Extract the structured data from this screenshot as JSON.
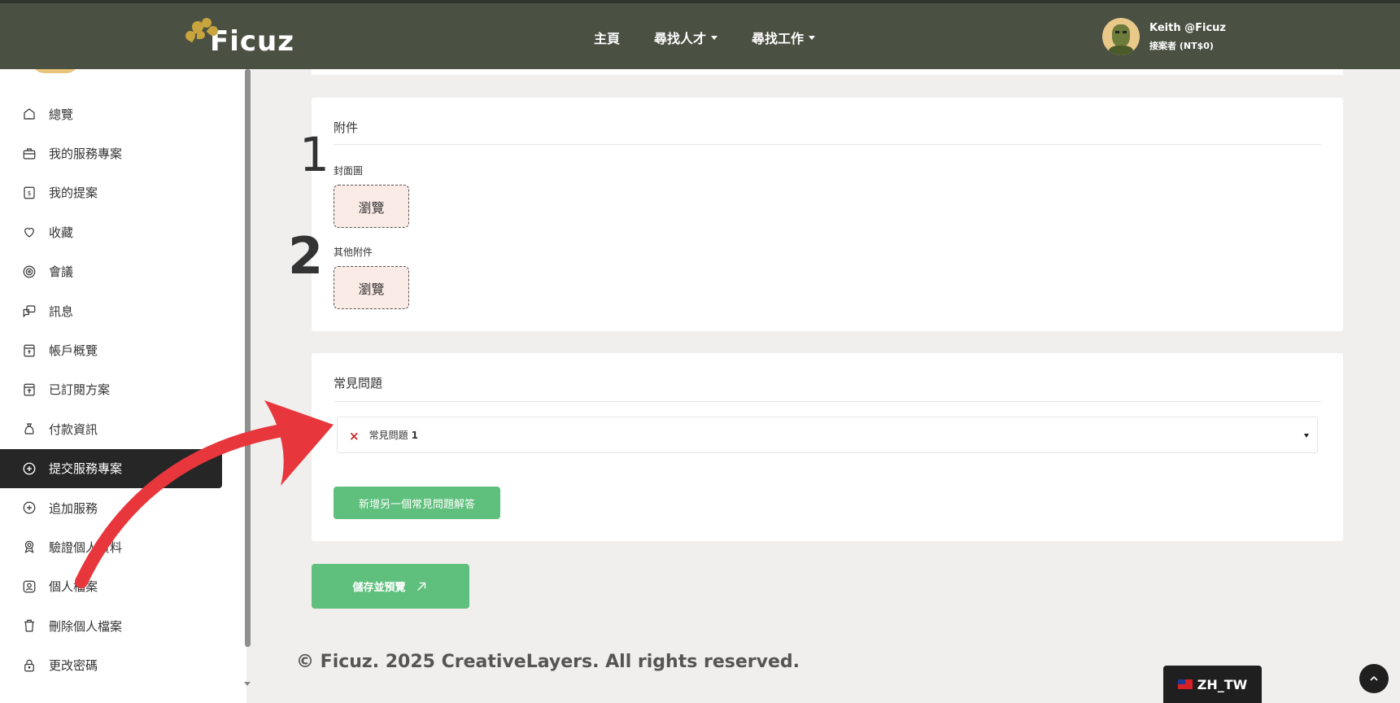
{
  "header": {
    "logo_text": "Ficuz",
    "nav": [
      {
        "label": "主頁",
        "has_caret": false
      },
      {
        "label": "尋找人才",
        "has_caret": true
      },
      {
        "label": "尋找工作",
        "has_caret": true
      }
    ],
    "user": {
      "name": "Keith @Ficuz",
      "role": "接案者 (NT$0)"
    }
  },
  "sidebar": {
    "items": [
      {
        "label": "總覽",
        "icon": "home-icon"
      },
      {
        "label": "我的服務專案",
        "icon": "briefcase-icon"
      },
      {
        "label": "我的提案",
        "icon": "dollar-file-icon"
      },
      {
        "label": "收藏",
        "icon": "heart-icon"
      },
      {
        "label": "會議",
        "icon": "target-icon"
      },
      {
        "label": "訊息",
        "icon": "chat-icon"
      },
      {
        "label": "帳戶概覽",
        "icon": "account-icon"
      },
      {
        "label": "已訂閱方案",
        "icon": "subscription-icon"
      },
      {
        "label": "付款資訊",
        "icon": "money-bag-icon"
      },
      {
        "label": "提交服務專案",
        "icon": "plus-circle-icon",
        "active": true
      },
      {
        "label": "追加服務",
        "icon": "plus-circle-icon"
      },
      {
        "label": "驗證個人資料",
        "icon": "badge-icon"
      },
      {
        "label": "個人檔案",
        "icon": "profile-icon"
      },
      {
        "label": "刪除個人檔案",
        "icon": "trash-icon"
      },
      {
        "label": "更改密碼",
        "icon": "lock-icon"
      }
    ]
  },
  "attachments": {
    "title": "附件",
    "cover_label": "封面圖",
    "other_label": "其他附件",
    "browse_label": "瀏覽"
  },
  "faq": {
    "title": "常見問題",
    "item_prefix": "常見問題",
    "item_number": "1",
    "add_label": "新增另一個常見問題解答"
  },
  "save_label": "儲存並預覽",
  "footer": {
    "copyright": "© Ficuz. 2025 CreativeLayers. All rights reserved."
  },
  "language": "ZH_TW",
  "annotations": {
    "one": "1",
    "two": "2"
  },
  "colors": {
    "header_bg": "#4a5143",
    "accent_green": "#5fbf7c",
    "arrow_red": "#e8373c",
    "active_item_bg": "#262626"
  }
}
